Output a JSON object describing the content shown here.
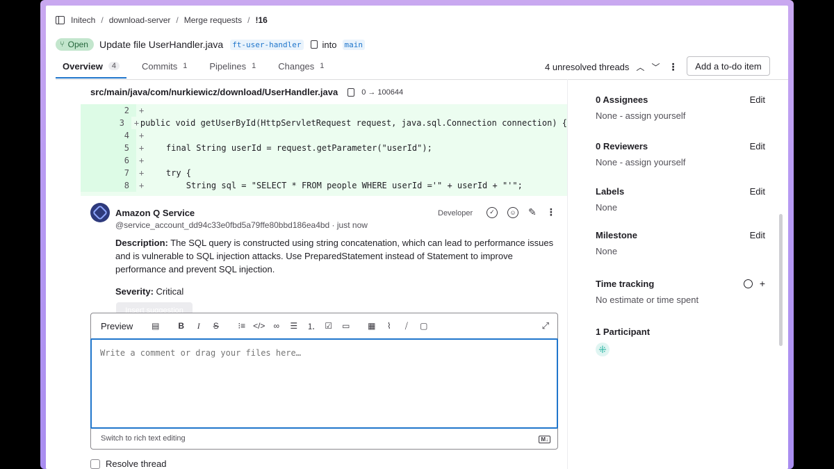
{
  "breadcrumb": {
    "items": [
      "Initech",
      "download-server",
      "Merge requests",
      "!16"
    ]
  },
  "mr": {
    "status": "Open",
    "title": "Update file UserHandler.java",
    "source_branch": "ft-user-handler",
    "into": "into",
    "target_branch": "main"
  },
  "tabs": [
    {
      "label": "Overview",
      "count": "4"
    },
    {
      "label": "Commits",
      "count": "1"
    },
    {
      "label": "Pipelines",
      "count": "1"
    },
    {
      "label": "Changes",
      "count": "1"
    }
  ],
  "threads": {
    "label": "4 unresolved threads"
  },
  "todo_button": "Add a to-do item",
  "file": {
    "path": "src/main/java/com/nurkiewicz/download/UserHandler.java",
    "mode": "0 → 100644"
  },
  "diff_lines": [
    {
      "n": "2",
      "code": ""
    },
    {
      "n": "3",
      "code": "public void getUserById(HttpServletRequest request, java.sql.Connection connection) {"
    },
    {
      "n": "4",
      "code": ""
    },
    {
      "n": "5",
      "code": "    final String userId = request.getParameter(\"userId\");"
    },
    {
      "n": "6",
      "code": ""
    },
    {
      "n": "7",
      "code": "    try {"
    },
    {
      "n": "8",
      "code": "        String sql = \"SELECT * FROM people WHERE userId ='\" + userId + \"'\";"
    }
  ],
  "comment": {
    "author": "Amazon Q Service",
    "handle": "@service_account_dd94c33e0fbd5a79ffe80bbd186ea4bd · just now",
    "role": "Developer",
    "description_label": "Description:",
    "description": " The SQL query is constructed using string concatenation, which can lead to performance issues and is vulnerable to SQL injection attacks. Use PreparedStatement instead of Statement to improve performance and prevent SQL injection.",
    "severity_label": "Severity:",
    "severity": " Critical",
    "insert_suggestion": "Insert suggestion"
  },
  "editor": {
    "preview": "Preview",
    "placeholder": "Write a comment or drag your files here…",
    "switch_label": "Switch to rich text editing",
    "md_badge": "M↓"
  },
  "resolve_label": "Resolve thread",
  "sidebar": {
    "assignees": {
      "title": "0 Assignees",
      "edit": "Edit",
      "value": "None - assign yourself"
    },
    "reviewers": {
      "title": "0 Reviewers",
      "edit": "Edit",
      "value": "None - assign yourself"
    },
    "labels": {
      "title": "Labels",
      "edit": "Edit",
      "value": "None"
    },
    "milestone": {
      "title": "Milestone",
      "edit": "Edit",
      "value": "None"
    },
    "time_tracking": {
      "title": "Time tracking",
      "value": "No estimate or time spent"
    },
    "participants": {
      "title": "1 Participant"
    }
  },
  "colors": {
    "accent": "#1f75cb",
    "diff_added_bg": "#ecfdf0",
    "open_badge_bg": "#c3e6cd",
    "frame": "#b79af2"
  }
}
